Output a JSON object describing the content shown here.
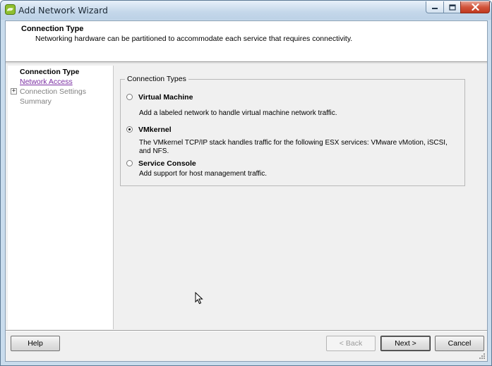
{
  "window": {
    "title": "Add Network Wizard",
    "app_icon": "vsphere-client-icon",
    "controls": {
      "minimize": "minimize-icon",
      "maximize": "maximize-icon",
      "close": "close-icon"
    }
  },
  "header": {
    "title": "Connection Type",
    "subtitle": "Networking hardware can be partitioned to accommodate each service that requires connectivity."
  },
  "steps": [
    {
      "label": "Connection Type",
      "state": "current"
    },
    {
      "label": "Network Access",
      "state": "link"
    },
    {
      "label": "Connection Settings",
      "state": "disabled",
      "expander": "+"
    },
    {
      "label": "Summary",
      "state": "disabled"
    }
  ],
  "connection_types": {
    "legend": "Connection Types",
    "selected": "VMkernel",
    "options": [
      {
        "label": "Virtual Machine",
        "description": "Add a labeled network to handle virtual machine network traffic.",
        "checked": false
      },
      {
        "label": "VMkernel",
        "description": "The VMkernel TCP/IP stack handles traffic for the following ESX services: VMware vMotion, iSCSI, and NFS.",
        "checked": true
      },
      {
        "label": "Service Console",
        "description": "Add support for host management traffic.",
        "checked": false
      }
    ]
  },
  "footer": {
    "help_label": "Help",
    "back_label": "< Back",
    "next_label": "Next >",
    "cancel_label": "Cancel"
  },
  "colors": {
    "link": "#7b2fa3",
    "disabled_text": "#808080",
    "title_bar": "#c4d7ea",
    "close_button": "#c0391f"
  }
}
